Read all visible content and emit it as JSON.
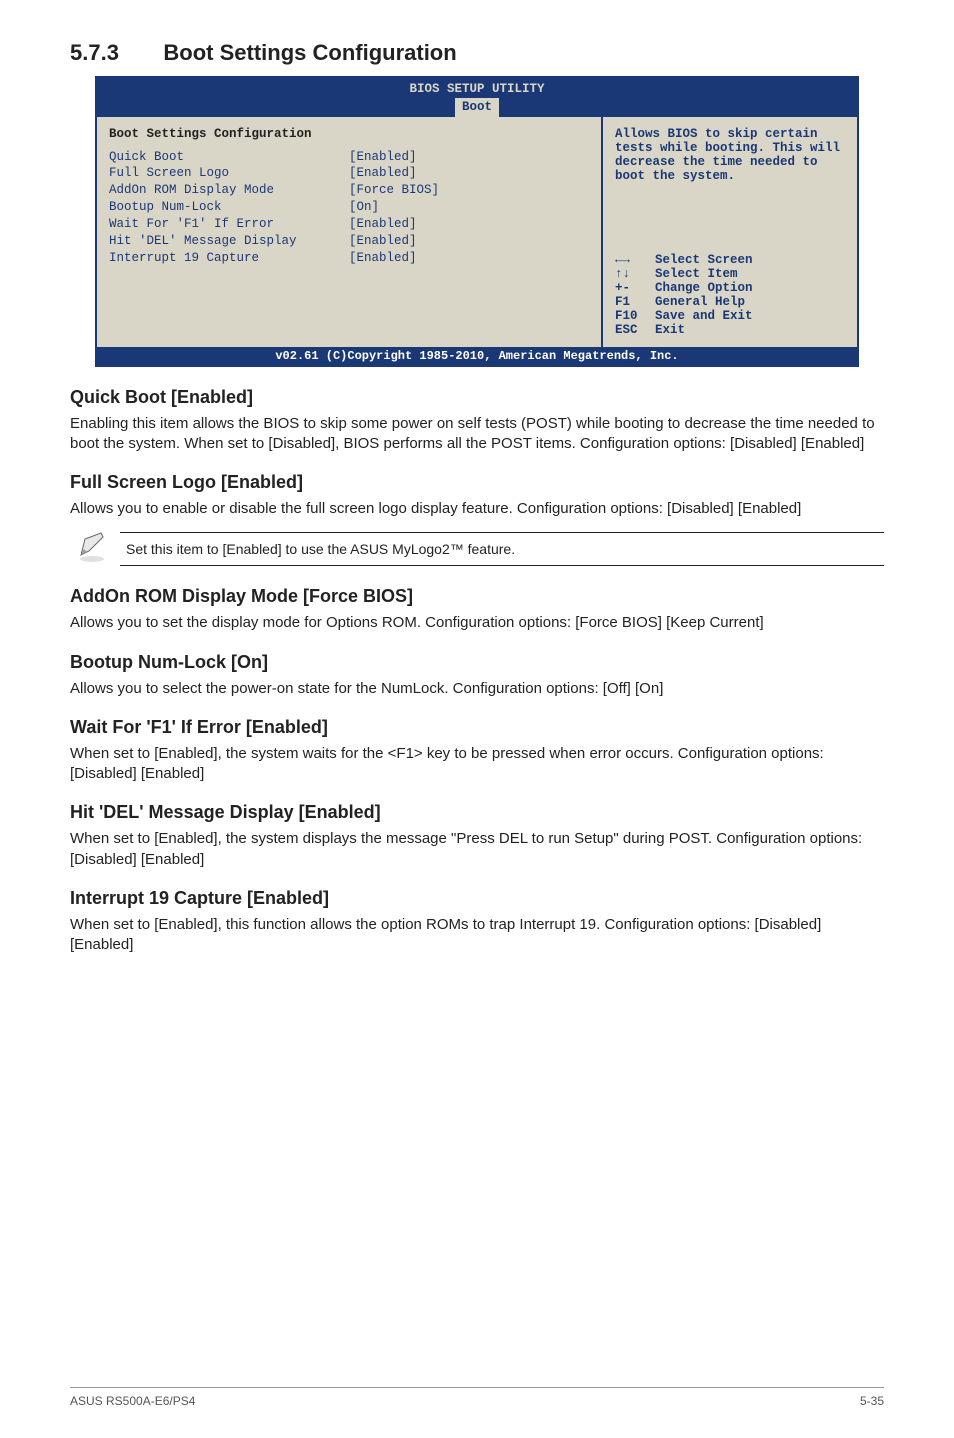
{
  "section": {
    "number": "5.7.3",
    "title": "Boot Settings Configuration"
  },
  "bios": {
    "header_line1": "BIOS SETUP UTILITY",
    "tab": "Boot",
    "panel_title": "Boot Settings Configuration",
    "rows": [
      {
        "label": "Quick Boot",
        "value": "[Enabled]"
      },
      {
        "label": "Full Screen Logo",
        "value": "[Enabled]"
      },
      {
        "label": "AddOn ROM Display Mode",
        "value": "[Force BIOS]"
      },
      {
        "label": "Bootup Num-Lock",
        "value": "[On]"
      },
      {
        "label": "Wait For 'F1' If Error",
        "value": "[Enabled]"
      },
      {
        "label": "Hit 'DEL' Message Display",
        "value": "[Enabled]"
      },
      {
        "label": "Interrupt 19 Capture",
        "value": "[Enabled]"
      }
    ],
    "help": "Allows BIOS to skip certain tests while booting. This will decrease the time needed to boot the system.",
    "keys": [
      {
        "key": "←→",
        "desc": "Select Screen"
      },
      {
        "key": "↑↓",
        "desc": "Select Item"
      },
      {
        "key": "+-",
        "desc": "Change Option"
      },
      {
        "key": "F1",
        "desc": "General Help"
      },
      {
        "key": "F10",
        "desc": "Save and Exit"
      },
      {
        "key": "ESC",
        "desc": "Exit"
      }
    ],
    "footer": "v02.61 (C)Copyright 1985-2010, American Megatrends, Inc."
  },
  "sections": {
    "quick_boot": {
      "title": "Quick Boot [Enabled]",
      "body": "Enabling this item allows the BIOS to skip some power on self tests (POST) while booting to decrease the time needed to boot the system. When set to [Disabled], BIOS performs all the POST items. Configuration options: [Disabled] [Enabled]"
    },
    "full_screen": {
      "title": "Full Screen Logo [Enabled]",
      "body": "Allows you to enable or disable the full screen logo display feature. Configuration options: [Disabled] [Enabled]"
    },
    "note": "Set this item to [Enabled] to use the ASUS MyLogo2™ feature.",
    "addon_rom": {
      "title": "AddOn ROM Display Mode [Force BIOS]",
      "body": "Allows you to set the display mode for Options ROM. Configuration options: [Force BIOS] [Keep Current]"
    },
    "numlock": {
      "title": "Bootup Num-Lock [On]",
      "body": "Allows you to select the power-on state for the NumLock. Configuration options: [Off] [On]"
    },
    "wait_f1": {
      "title": "Wait For 'F1' If Error [Enabled]",
      "body": "When set to [Enabled], the system waits for the <F1> key to be pressed when error occurs. Configuration options: [Disabled] [Enabled]"
    },
    "hit_del": {
      "title": "Hit 'DEL' Message Display [Enabled]",
      "body": "When set to [Enabled], the system displays the message \"Press DEL to run Setup\" during POST. Configuration options: [Disabled] [Enabled]"
    },
    "int19": {
      "title": "Interrupt 19 Capture [Enabled]",
      "body": "When set to [Enabled], this function allows the option ROMs to trap Interrupt 19. Configuration options: [Disabled] [Enabled]"
    }
  },
  "footer": {
    "left": "ASUS RS500A-E6/PS4",
    "right": "5-35"
  }
}
